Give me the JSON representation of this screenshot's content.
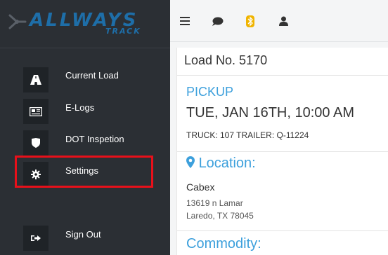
{
  "brand": {
    "name": "ALLWAYS",
    "sub": "TRACK"
  },
  "sidebar": {
    "items": [
      {
        "label": "Current Load",
        "icon": "road-icon"
      },
      {
        "label": "E-Logs",
        "icon": "newspaper-icon"
      },
      {
        "label": "DOT Inspetion",
        "icon": "shield-icon"
      },
      {
        "label": "Settings",
        "icon": "gear-icon",
        "highlighted": true
      },
      {
        "label": "Sign Out",
        "icon": "sign-out-icon"
      }
    ]
  },
  "topbar": {
    "icons": [
      "menu-icon",
      "chat-icon",
      "bluetooth-icon",
      "user-icon"
    ]
  },
  "load": {
    "title": "Load No. 5170",
    "pickup_label": "PICKUP",
    "datetime": "TUE, JAN 16TH, 10:00 AM",
    "truck_info": "TRUCK: 107  TRAILER: Q-11224",
    "location_heading": "Location:",
    "company": "Cabex",
    "address_line1": "13619 n Lamar",
    "address_line2": "Laredo, TX 78045",
    "commodity_heading": "Commodity:"
  },
  "colors": {
    "sidebar_bg": "#2b2f34",
    "accent_blue": "#3da0dc",
    "highlight_red": "#e8101a",
    "bluetooth_yellow": "#f0b400"
  }
}
